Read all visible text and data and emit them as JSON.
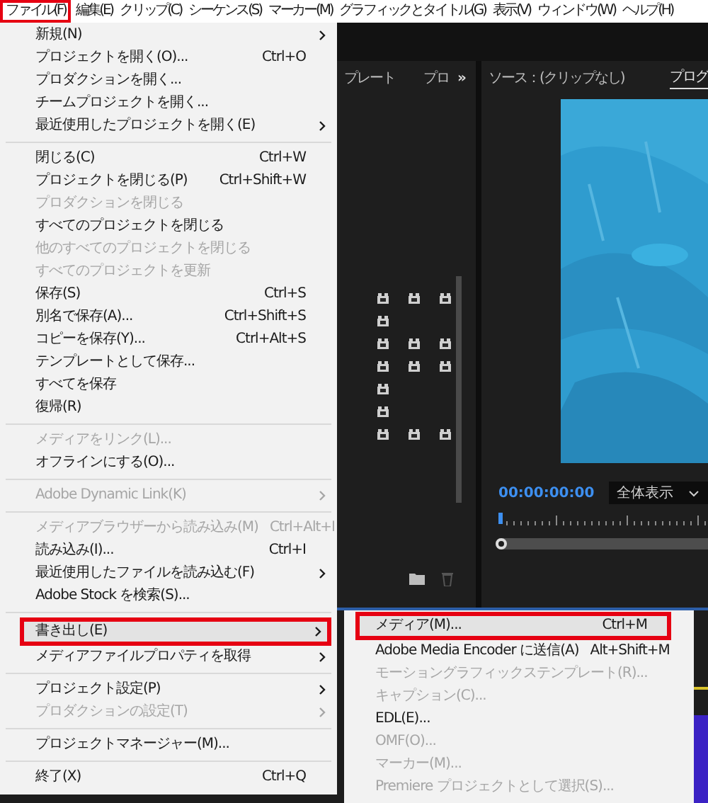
{
  "menu_bar": [
    {
      "label": "ファイル(F)",
      "selected": true
    },
    {
      "label": "編集(E)",
      "selected": false
    },
    {
      "label": "クリップ(C)",
      "selected": false
    },
    {
      "label": "シーケンス(S)",
      "selected": false
    },
    {
      "label": "マーカー(M)",
      "selected": false
    },
    {
      "label": "グラフィックとタイトル(G)",
      "selected": false
    },
    {
      "label": "表示(V)",
      "selected": false
    },
    {
      "label": "ウィンドウ(W)",
      "selected": false
    },
    {
      "label": "ヘルプ(H)",
      "selected": false
    }
  ],
  "project_panel": {
    "tabs": [
      {
        "label": "プレート"
      },
      {
        "label": "プロ"
      }
    ],
    "overflow": "»"
  },
  "monitor": {
    "tabs": [
      {
        "label": "ソース：(クリップなし)",
        "selected": false
      },
      {
        "label": "プログ",
        "selected": true
      }
    ],
    "timecode": "00:00:00:00",
    "zoom": "全体表示"
  },
  "file_menu": [
    {
      "kind": "item",
      "label": "新規(N)",
      "submenu": true,
      "disabled": false,
      "selected": false
    },
    {
      "kind": "item",
      "label": "プロジェクトを開く(O)...",
      "shortcut": "Ctrl+O",
      "disabled": false,
      "selected": false
    },
    {
      "kind": "item",
      "label": "プロダクションを開く...",
      "disabled": false,
      "selected": false
    },
    {
      "kind": "item",
      "label": "チームプロジェクトを開く...",
      "disabled": false,
      "selected": false
    },
    {
      "kind": "item",
      "label": "最近使用したプロジェクトを開く(E)",
      "submenu": true,
      "disabled": false,
      "selected": false
    },
    {
      "kind": "separator"
    },
    {
      "kind": "item",
      "label": "閉じる(C)",
      "shortcut": "Ctrl+W",
      "disabled": false,
      "selected": false
    },
    {
      "kind": "item",
      "label": "プロジェクトを閉じる(P)",
      "shortcut": "Ctrl+Shift+W",
      "disabled": false,
      "selected": false
    },
    {
      "kind": "item",
      "label": "プロダクションを閉じる",
      "disabled": true,
      "selected": false
    },
    {
      "kind": "item",
      "label": "すべてのプロジェクトを閉じる",
      "disabled": false,
      "selected": false
    },
    {
      "kind": "item",
      "label": "他のすべてのプロジェクトを閉じる",
      "disabled": true,
      "selected": false
    },
    {
      "kind": "item",
      "label": "すべてのプロジェクトを更新",
      "disabled": true,
      "selected": false
    },
    {
      "kind": "item",
      "label": "保存(S)",
      "shortcut": "Ctrl+S",
      "disabled": false,
      "selected": false
    },
    {
      "kind": "item",
      "label": "別名で保存(A)...",
      "shortcut": "Ctrl+Shift+S",
      "disabled": false,
      "selected": false
    },
    {
      "kind": "item",
      "label": "コピーを保存(Y)...",
      "shortcut": "Ctrl+Alt+S",
      "disabled": false,
      "selected": false
    },
    {
      "kind": "item",
      "label": "テンプレートとして保存...",
      "disabled": false,
      "selected": false
    },
    {
      "kind": "item",
      "label": "すべてを保存",
      "disabled": false,
      "selected": false
    },
    {
      "kind": "item",
      "label": "復帰(R)",
      "disabled": false,
      "selected": false
    },
    {
      "kind": "separator"
    },
    {
      "kind": "item",
      "label": "メディアをリンク(L)...",
      "disabled": true,
      "selected": false
    },
    {
      "kind": "item",
      "label": "オフラインにする(O)...",
      "disabled": false,
      "selected": false
    },
    {
      "kind": "separator"
    },
    {
      "kind": "item",
      "label": "Adobe Dynamic Link(K)",
      "submenu": true,
      "disabled": true,
      "selected": false
    },
    {
      "kind": "separator"
    },
    {
      "kind": "item",
      "label": "メディアブラウザーから読み込み(M)",
      "shortcut": "Ctrl+Alt+I",
      "disabled": true,
      "selected": false
    },
    {
      "kind": "item",
      "label": "読み込み(I)...",
      "shortcut": "Ctrl+I",
      "disabled": false,
      "selected": false
    },
    {
      "kind": "item",
      "label": "最近使用したファイルを読み込む(F)",
      "submenu": true,
      "disabled": false,
      "selected": false
    },
    {
      "kind": "item",
      "label": "Adobe Stock を検索(S)...",
      "disabled": false,
      "selected": false
    },
    {
      "kind": "separator"
    },
    {
      "kind": "item",
      "label": "書き出し(E)",
      "submenu": true,
      "disabled": false,
      "selected": true
    },
    {
      "kind": "item",
      "label": "メディアファイルプロパティを取得",
      "submenu": true,
      "disabled": false,
      "selected": false
    },
    {
      "kind": "separator"
    },
    {
      "kind": "item",
      "label": "プロジェクト設定(P)",
      "submenu": true,
      "disabled": false,
      "selected": false
    },
    {
      "kind": "item",
      "label": "プロダクションの設定(T)",
      "submenu": true,
      "disabled": true,
      "selected": false
    },
    {
      "kind": "separator"
    },
    {
      "kind": "item",
      "label": "プロジェクトマネージャー(M)...",
      "disabled": false,
      "selected": false
    },
    {
      "kind": "separator"
    },
    {
      "kind": "item",
      "label": "終了(X)",
      "shortcut": "Ctrl+Q",
      "disabled": false,
      "selected": false
    }
  ],
  "export_submenu": [
    {
      "kind": "item",
      "label": "メディア(M)...",
      "shortcut": "Ctrl+M",
      "disabled": false,
      "selected": true
    },
    {
      "kind": "item",
      "label": "Adobe Media Encoder に送信(A)",
      "shortcut": "Alt+Shift+M",
      "disabled": false,
      "selected": false
    },
    {
      "kind": "item",
      "label": "モーショングラフィックステンプレート(R)...",
      "disabled": true,
      "selected": false
    },
    {
      "kind": "item",
      "label": "キャプション(C)...",
      "disabled": true,
      "selected": false
    },
    {
      "kind": "item",
      "label": "EDL(E)...",
      "disabled": false,
      "selected": false
    },
    {
      "kind": "item",
      "label": "OMF(O)...",
      "disabled": true,
      "selected": false
    },
    {
      "kind": "item",
      "label": "マーカー(M)...",
      "disabled": true,
      "selected": false
    },
    {
      "kind": "item",
      "label": "Premiere プロジェクトとして選択(S)...",
      "disabled": true,
      "selected": false
    }
  ]
}
